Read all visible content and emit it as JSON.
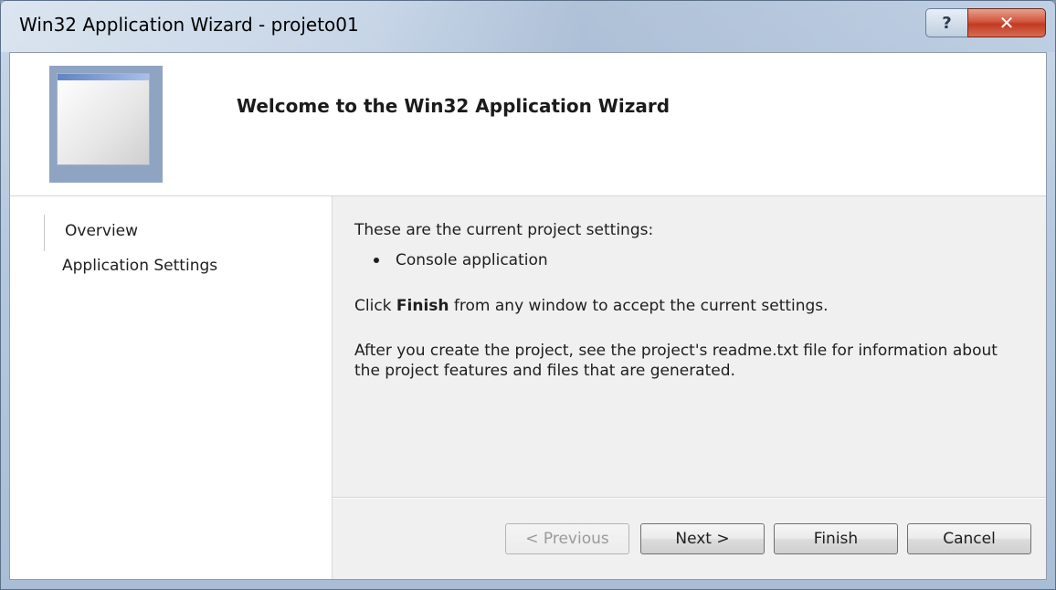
{
  "window": {
    "title": "Win32 Application Wizard - projeto01",
    "help_icon": "question-mark",
    "close_icon": "x"
  },
  "header": {
    "title": "Welcome to the Win32 Application Wizard"
  },
  "sidebar": {
    "items": [
      {
        "label": "Overview"
      },
      {
        "label": "Application Settings"
      }
    ]
  },
  "main": {
    "settings_intro": "These are the current project settings:",
    "settings": [
      "Console application"
    ],
    "finish_hint_prefix": "Click ",
    "finish_hint_bold": "Finish",
    "finish_hint_suffix": " from any window to accept the current settings.",
    "readme_note": "After you create the project, see the project's readme.txt file for information about the project features and files that are generated."
  },
  "buttons": {
    "previous": "< Previous",
    "next": "Next >",
    "finish": "Finish",
    "cancel": "Cancel"
  },
  "colors": {
    "close_button": "#c13b23",
    "header_bg": "#ffffff",
    "content_bg": "#f0f0f0"
  }
}
